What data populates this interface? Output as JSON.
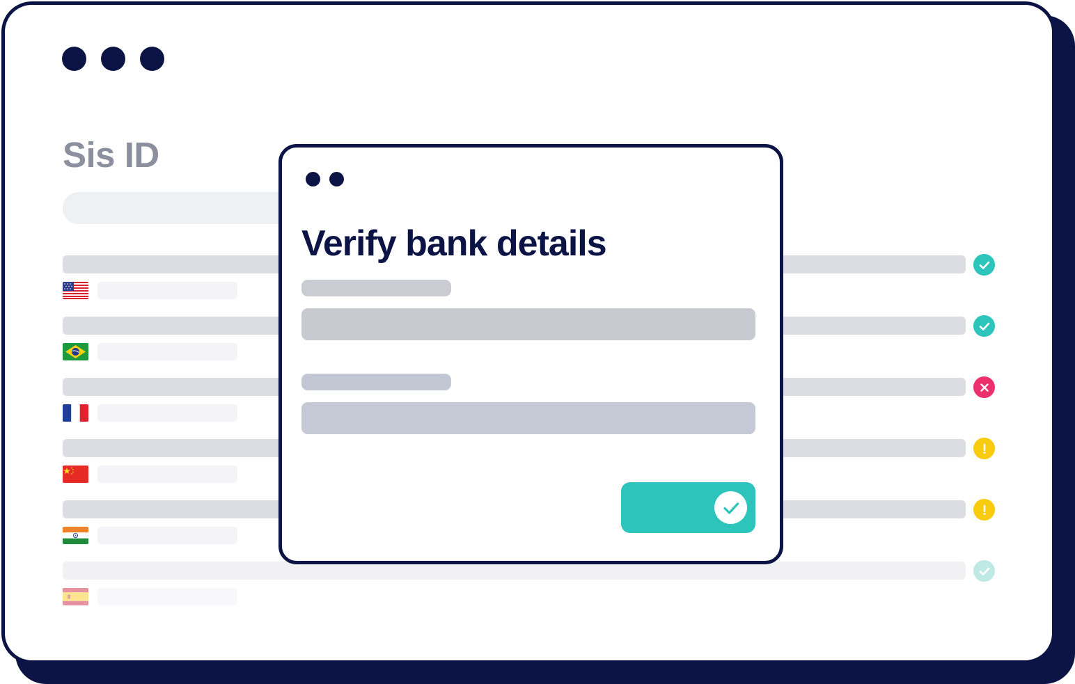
{
  "app": {
    "brand": "Sis ID"
  },
  "modal": {
    "title": "Verify bank details",
    "fields": [
      {
        "label_placeholder_color": "#cbccd3",
        "input_color": "#c8c9d1"
      },
      {
        "label_placeholder_color": "#c3c7d3",
        "input_color": "#c5c8d5"
      }
    ],
    "confirm_button": {
      "icon": "check-icon",
      "color": "#2cc4bb"
    }
  },
  "rows": [
    {
      "flag": "us-flag-icon",
      "status": "verified",
      "status_icon": "check-icon"
    },
    {
      "flag": "brazil-flag-icon",
      "status": "verified",
      "status_icon": "check-icon"
    },
    {
      "flag": "france-flag-icon",
      "status": "rejected",
      "status_icon": "x-icon"
    },
    {
      "flag": "china-flag-icon",
      "status": "warning",
      "status_icon": "exclamation-icon"
    },
    {
      "flag": "india-flag-icon",
      "status": "warning",
      "status_icon": "exclamation-icon"
    },
    {
      "flag": "spain-flag-icon",
      "status": "verified-faded",
      "status_icon": "check-icon"
    }
  ],
  "colors": {
    "navy": "#0c1445",
    "teal": "#2cc4bb",
    "pink": "#ec2f6d",
    "yellow": "#f8cb0d",
    "gray_bar": "#dcdde2",
    "brand_gray": "#8c909e"
  }
}
